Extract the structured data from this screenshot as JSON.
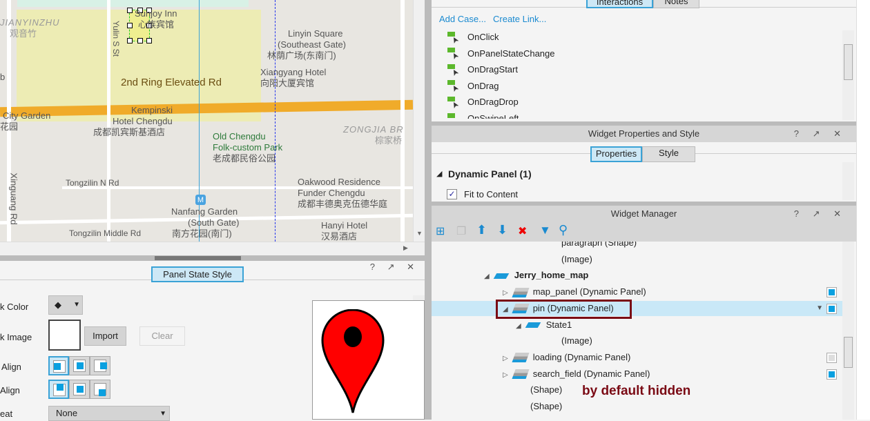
{
  "map": {
    "labels": [
      "Sunjoy Inn",
      "心族宾馆",
      "JIANYINZHU",
      "观音竹",
      "Yulin S St",
      "Linyin Square",
      "(Southeast Gate)",
      "林荫广场(东南门)",
      "Xiangyang Hotel",
      "向阳大厦宾馆",
      "2nd Ring Elevated Rd",
      "City Garden",
      "花园",
      "Kempinski",
      "Hotel Chengdu",
      "成都凯宾斯基酒店",
      "Old Chengdu",
      "Folk-custom Park",
      "老成都民俗公园",
      "ZONGJIA BR",
      "棕家桥",
      "Tongzilin N Rd",
      "Oakwood Residence",
      "Funder Chengdu",
      "成都丰德奥克伍德华庭",
      "Xinguang Rd",
      "Nanfang Garden",
      "(South Gate)",
      "南方花园(南门)",
      "Tongzilin Middle Rd",
      "Hanyi Hotel",
      "汉易酒店",
      "b",
      "M"
    ]
  },
  "interactions": {
    "tabs": [
      "Interactions",
      "Notes"
    ],
    "add_case": "Add Case...",
    "create_link": "Create Link...",
    "events": [
      "OnClick",
      "OnPanelStateChange",
      "OnDragStart",
      "OnDrag",
      "OnDragDrop",
      "OnSwipeLeft"
    ]
  },
  "props": {
    "title": "Widget Properties and Style",
    "tabs": [
      "Properties",
      "Style"
    ],
    "section": "Dynamic Panel (1)",
    "fit_label": "Fit to Content",
    "fit_checked": true
  },
  "manager": {
    "title": "Widget Manager",
    "toolbar": [
      "add-folder-icon",
      "copy-icon",
      "move-up-icon",
      "move-down-icon",
      "delete-icon",
      "filter-icon",
      "search-icon"
    ],
    "rows": [
      {
        "label": "paragraph (Shape)"
      },
      {
        "label": "(Image)"
      },
      {
        "label": "Jerry_home_map"
      },
      {
        "label": "map_panel (Dynamic Panel)",
        "visible": true
      },
      {
        "label": "pin (Dynamic Panel)",
        "visible": true,
        "selected": true
      },
      {
        "label": "State1"
      },
      {
        "label": "(Image)"
      },
      {
        "label": "loading (Dynamic Panel)",
        "visible": false
      },
      {
        "label": "search_field (Dynamic Panel)",
        "visible": true
      },
      {
        "label": "(Shape)"
      },
      {
        "label": "(Shape)"
      }
    ],
    "annotation": "by default hidden",
    "annotation_color": "#7a0a14"
  },
  "style_panel": {
    "tab": "Panel State Style",
    "labels": [
      "k Color",
      "k Image",
      "Align",
      "Align",
      "eat"
    ],
    "import": "Import",
    "clear": "Clear",
    "repeat_value": "None"
  },
  "header_icons": "? ↗ ✕",
  "pin_color": "#ff0000"
}
